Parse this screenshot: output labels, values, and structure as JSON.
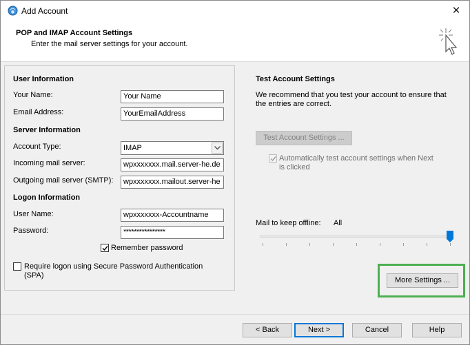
{
  "window": {
    "title": "Add Account",
    "close_glyph": "✕",
    "icon": "outlook-account-icon"
  },
  "header": {
    "title": "POP and IMAP Account Settings",
    "subtitle": "Enter the mail server settings for your account.",
    "icon": "cursor-click-icon"
  },
  "user_info": {
    "heading": "User Information",
    "name_label": "Your Name:",
    "name_value": "Your Name",
    "email_label": "Email Address:",
    "email_value": "YourEmailAddress"
  },
  "server_info": {
    "heading": "Server Information",
    "account_type_label": "Account Type:",
    "account_type_value": "IMAP",
    "incoming_label": "Incoming mail server:",
    "incoming_value": "wpxxxxxxx.mail.server-he.de",
    "outgoing_label": "Outgoing mail server (SMTP):",
    "outgoing_value": "wpxxxxxxx.mailout.server-he"
  },
  "logon_info": {
    "heading": "Logon Information",
    "username_label": "User Name:",
    "username_value": "wpxxxxxxx-Accountname",
    "password_label": "Password:",
    "password_value": "****************",
    "remember_label": "Remember password",
    "remember_checked": true,
    "spa_label_line1": "Require logon using Secure Password Authentication",
    "spa_label_line2": "(SPA)",
    "spa_checked": false
  },
  "test": {
    "heading": "Test Account Settings",
    "desc_line1": "We recommend that you test your account to ensure that",
    "desc_line2": "the entries are correct.",
    "button": "Test Account Settings ...",
    "auto_line1": "Automatically test account settings when Next",
    "auto_line2": "is clicked",
    "auto_checked": true
  },
  "offline": {
    "label": "Mail to keep offline:",
    "value": "All",
    "slider_fraction": 1.0
  },
  "more_settings": "More Settings ...",
  "footer": {
    "back": "< Back",
    "next": "Next >",
    "cancel": "Cancel",
    "help": "Help"
  },
  "colors": {
    "highlight": "#4caf50",
    "primary_border": "#0078d7"
  }
}
